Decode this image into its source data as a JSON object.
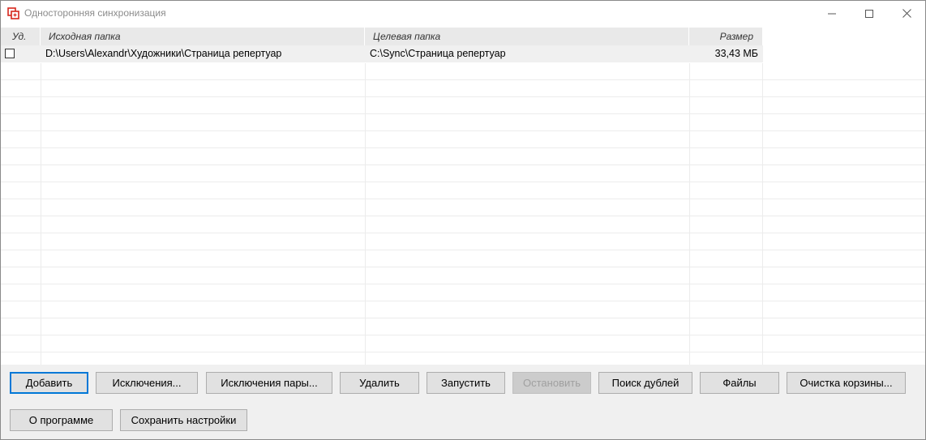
{
  "window": {
    "title": "Односторонняя синхронизация"
  },
  "table": {
    "columns": [
      "Уд.",
      "Исходная папка",
      "Целевая папка",
      "Размер"
    ],
    "rows": [
      {
        "checked": false,
        "source": "D:\\Users\\Alexandr\\Художники\\Страница репертуар",
        "target": "C:\\Sync\\Страница репертуар",
        "size": "33,43 МБ"
      }
    ]
  },
  "buttons": {
    "add": "Добавить",
    "exclusions": "Исключения...",
    "pair_exclusions": "Исключения пары...",
    "delete": "Удалить",
    "start": "Запустить",
    "stop": "Остановить",
    "find_duplicates": "Поиск дублей",
    "files": "Файлы",
    "clear_trash": "Очистка корзины...",
    "about": "О программе",
    "save_settings": "Сохранить настройки"
  },
  "colors": {
    "accent": "#0078d7",
    "app_icon": "#d6261c"
  }
}
